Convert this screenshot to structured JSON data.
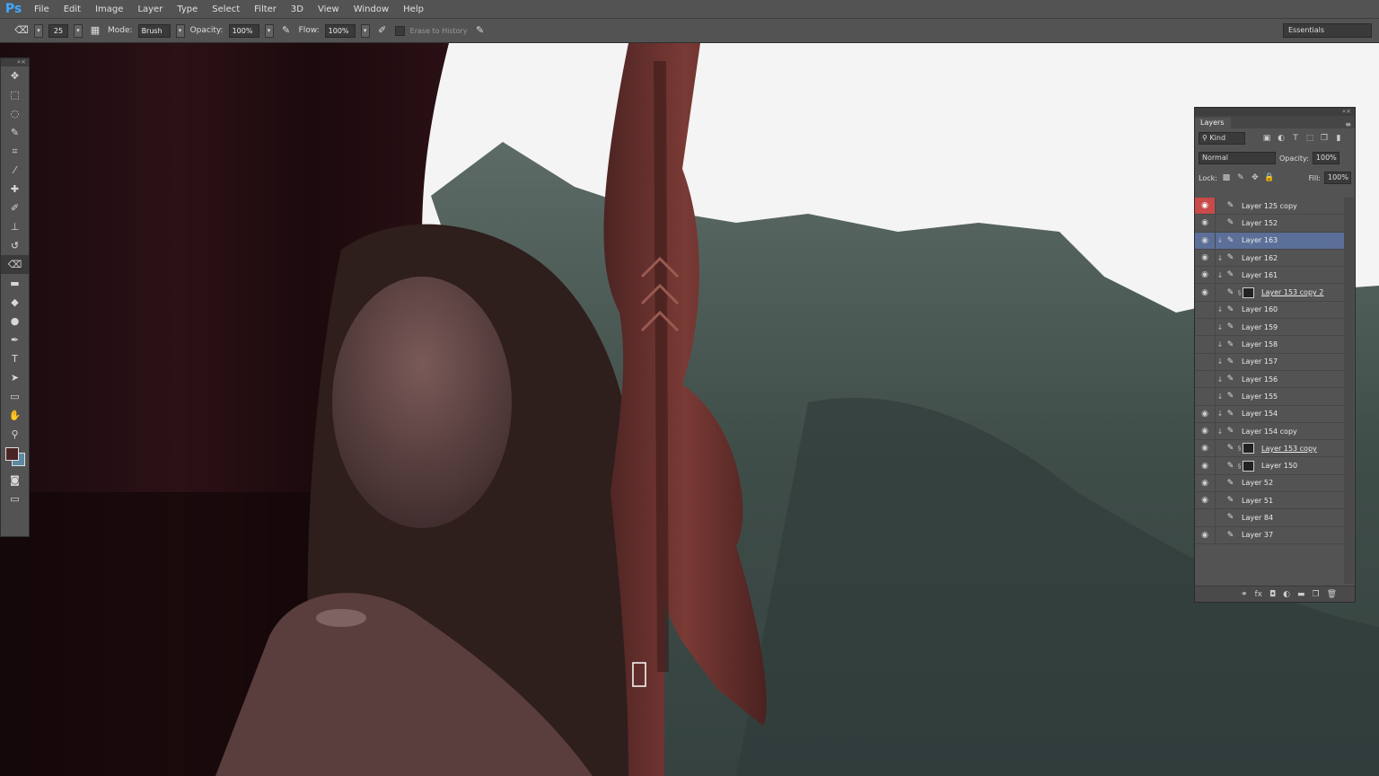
{
  "app": {
    "logo": "Ps"
  },
  "menu": [
    "File",
    "Edit",
    "Image",
    "Layer",
    "Type",
    "Select",
    "Filter",
    "3D",
    "View",
    "Window",
    "Help"
  ],
  "options": {
    "brush_size": "25",
    "mode_label": "Mode:",
    "mode_value": "Brush",
    "opacity_label": "Opacity:",
    "opacity_value": "100%",
    "flow_label": "Flow:",
    "flow_value": "100%",
    "erase_label": "Erase to History",
    "workspace": "Essentials"
  },
  "layers_panel": {
    "tab": "Layers",
    "kind": "Kind",
    "blend": "Normal",
    "opacity_label": "Opacity:",
    "opacity_value": "100%",
    "lock_label": "Lock:",
    "fill_label": "Fill:",
    "fill_value": "100%",
    "layers": [
      {
        "name": "Layer 125 copy",
        "visible": true,
        "eye_red": true
      },
      {
        "name": "Layer 152",
        "visible": true
      },
      {
        "name": "Layer 163",
        "visible": true,
        "selected": true,
        "clip": true
      },
      {
        "name": "Layer 162",
        "visible": true,
        "clip": true
      },
      {
        "name": "Layer 161",
        "visible": true,
        "clip": true
      },
      {
        "name": "Layer 153 copy 2",
        "visible": true,
        "mask": true,
        "underline": true
      },
      {
        "name": "Layer 160",
        "visible": false,
        "clip": true
      },
      {
        "name": "Layer 159",
        "visible": false,
        "clip": true
      },
      {
        "name": "Layer 158",
        "visible": false,
        "clip": true
      },
      {
        "name": "Layer 157",
        "visible": false,
        "clip": true
      },
      {
        "name": "Layer 156",
        "visible": false,
        "clip": true
      },
      {
        "name": "Layer 155",
        "visible": false,
        "clip": true
      },
      {
        "name": "Layer 154",
        "visible": true,
        "clip": true
      },
      {
        "name": "Layer 154 copy",
        "visible": true,
        "clip": true
      },
      {
        "name": "Layer 153 copy",
        "visible": true,
        "mask": true,
        "underline": true
      },
      {
        "name": "Layer 150",
        "visible": true,
        "mask": true
      },
      {
        "name": "Layer 52",
        "visible": true
      },
      {
        "name": "Layer 51",
        "visible": true
      },
      {
        "name": "Layer 84",
        "visible": false
      },
      {
        "name": "Layer 37",
        "visible": true
      }
    ]
  },
  "icons": {
    "eye": "eye-icon",
    "brush": "brush-icon",
    "link": "link-icon"
  },
  "colors": {
    "selected_layer": "#5b6f98",
    "eye_highlight": "#c84a4a",
    "ps_blue": "#3fa9ff"
  }
}
